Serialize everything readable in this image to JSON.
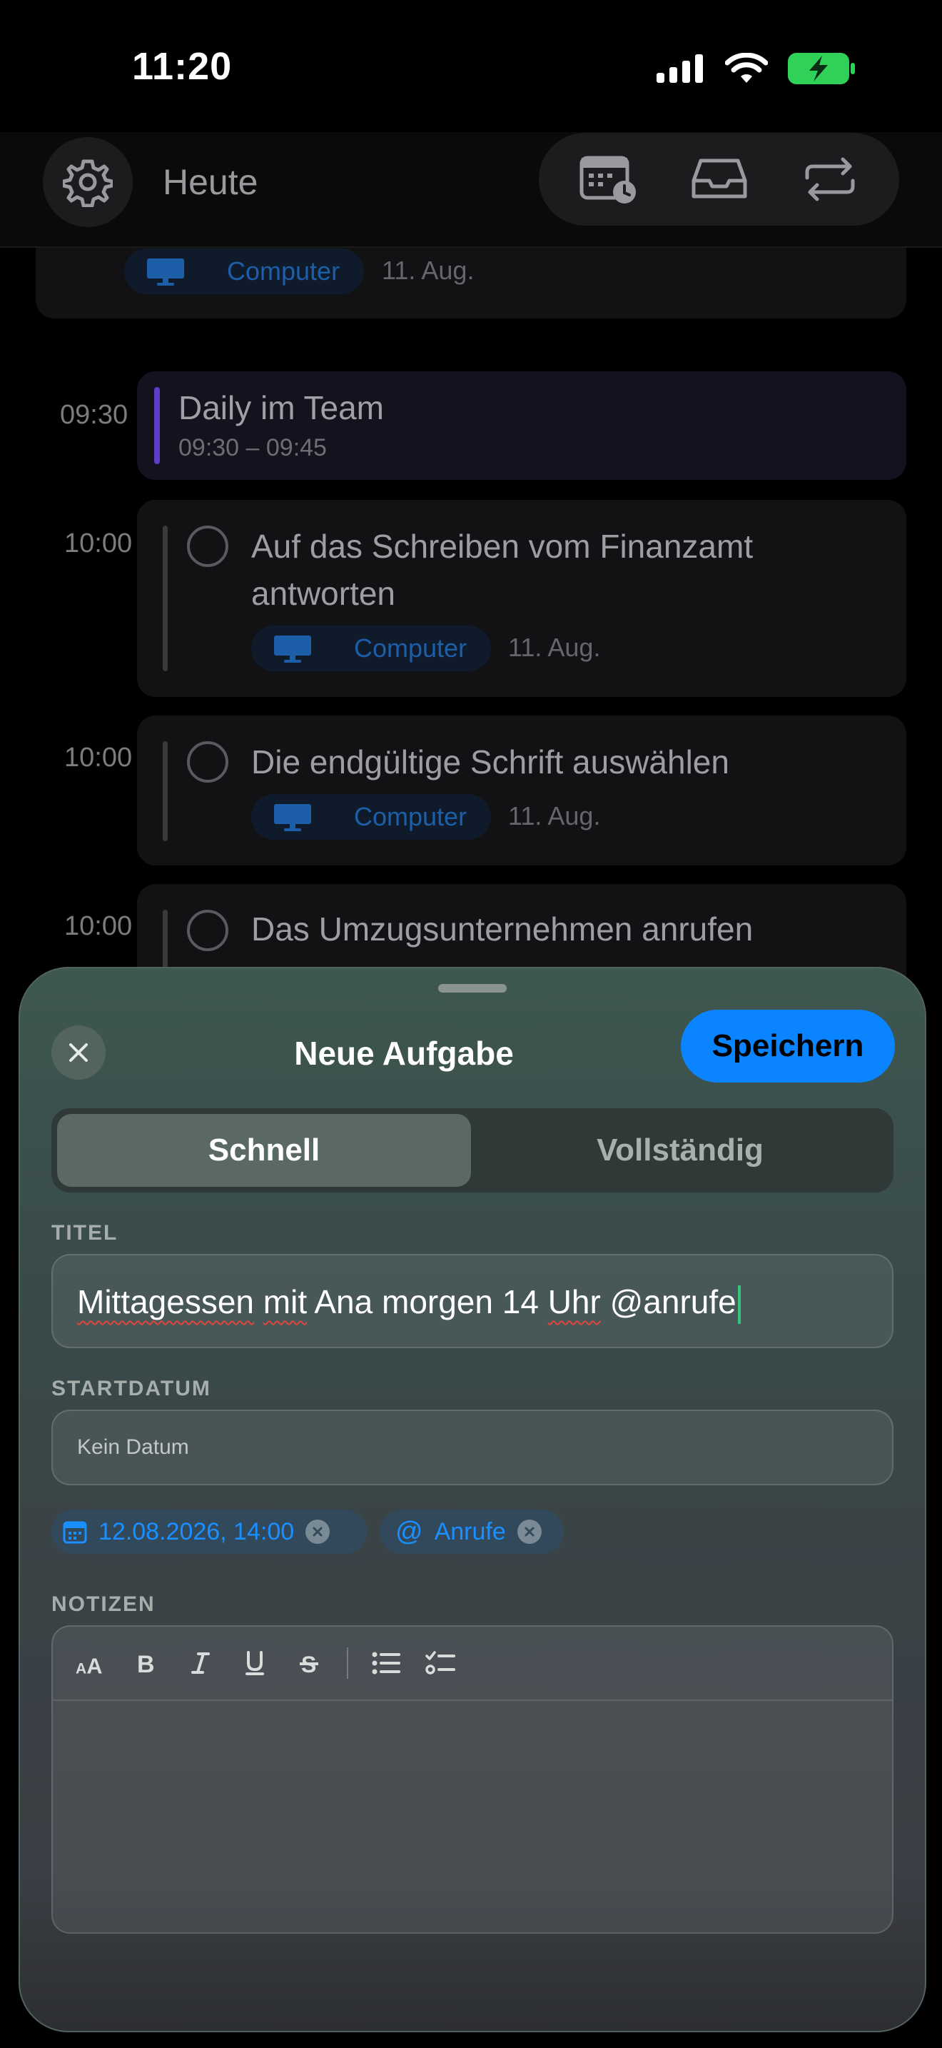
{
  "status_bar": {
    "time": "11:20"
  },
  "header": {
    "title": "Heute"
  },
  "list": {
    "top_card": {
      "tag": "Computer",
      "date": "11. Aug."
    },
    "event": {
      "time": "09:30",
      "title": "Daily im Team",
      "range": "09:30 – 09:45",
      "accent": "#5b3fc8"
    },
    "tasks": [
      {
        "time": "10:00",
        "title_line1": "Auf das Schreiben vom Finanzamt",
        "title_line2": "antworten",
        "tag": "Computer",
        "date": "11. Aug."
      },
      {
        "time": "10:00",
        "title": "Die endgültige Schrift auswählen",
        "tag": "Computer",
        "date": "11. Aug."
      },
      {
        "time": "10:00",
        "title": "Das Umzugsunternehmen anrufen"
      }
    ]
  },
  "sheet": {
    "title": "Neue Aufgabe",
    "save_label": "Speichern",
    "segments": {
      "quick": "Schnell",
      "full": "Vollständig"
    },
    "title_label": "TITEL",
    "title_value": {
      "w1": "Mittagessen",
      "w2": "mit",
      "w3": "Ana morgen 14",
      "w4": "Uhr",
      "w5": "@anrufe"
    },
    "start_label": "STARTDATUM",
    "start_placeholder": "Kein Datum",
    "chips": {
      "date": "12.08.2026, 14:00",
      "context": "Anrufe"
    },
    "notes_label": "NOTIZEN",
    "accent": "#0a84ff"
  }
}
